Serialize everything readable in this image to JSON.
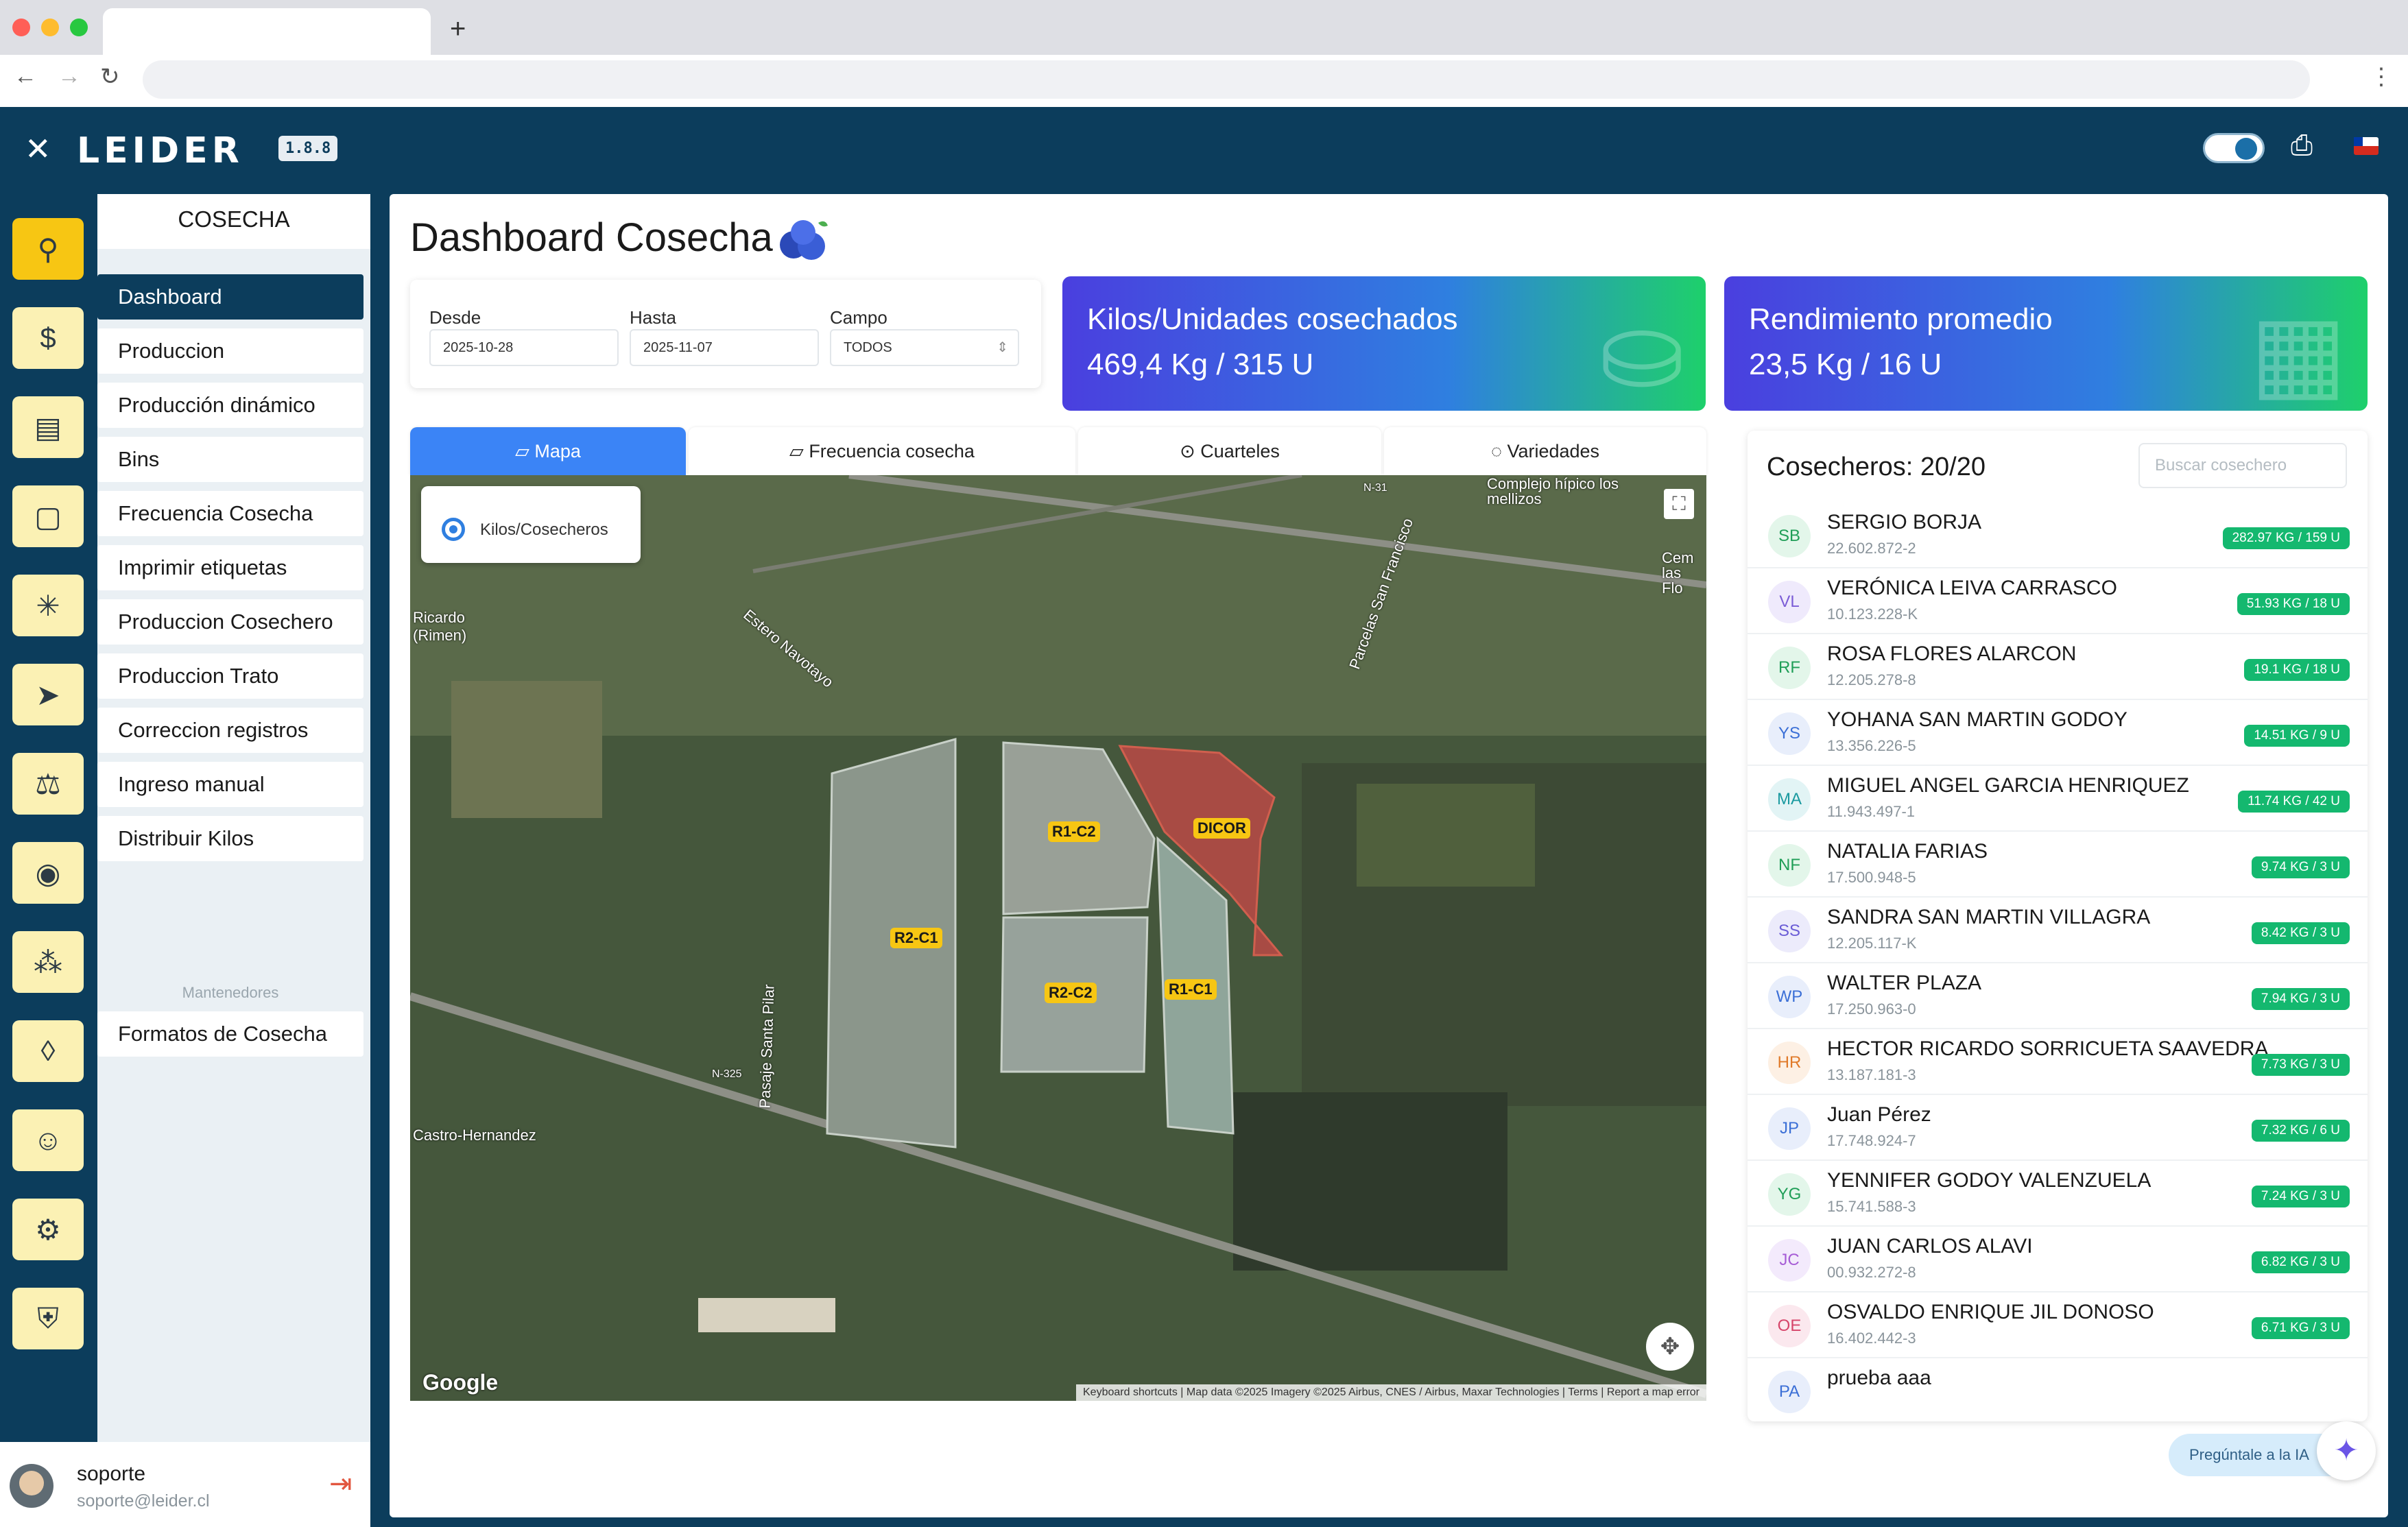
{
  "browser": {
    "new_tab": "+",
    "back": "←",
    "forward": "→",
    "reload": "↻",
    "menu": "⋮"
  },
  "app": {
    "close": "✕",
    "logo": "LEIDER",
    "version": "1.8.8"
  },
  "rail": {
    "icons": [
      "bike-icon",
      "invoice-icon",
      "receipt-icon",
      "clipboard-icon",
      "bug-icon",
      "navigation-icon",
      "scale-icon",
      "antenna-icon",
      "group-icon",
      "water-cost-icon",
      "worker-icon",
      "gear-icon",
      "shield-icon"
    ]
  },
  "submenu": {
    "title": "COSECHA",
    "items": [
      "Dashboard",
      "Produccion",
      "Producción dinámico",
      "Bins",
      "Frecuencia Cosecha",
      "Imprimir etiquetas",
      "Produccion Cosechero",
      "Produccion Trato",
      "Correccion registros",
      "Ingreso manual",
      "Distribuir Kilos"
    ],
    "section": "Mantenedores",
    "section_items": [
      "Formatos de Cosecha"
    ]
  },
  "user": {
    "name": "soporte",
    "email": "soporte@leider.cl"
  },
  "page": {
    "title": "Dashboard Cosecha"
  },
  "filters": {
    "desde_label": "Desde",
    "desde_value": "2025-10-28",
    "hasta_label": "Hasta",
    "hasta_value": "2025-11-07",
    "campo_label": "Campo",
    "campo_value": "TODOS"
  },
  "cards": [
    {
      "title": "Kilos/Unidades cosechados",
      "value": "469,4 Kg / 315 U"
    },
    {
      "title": "Rendimiento promedio",
      "value": "23,5 Kg / 16 U"
    }
  ],
  "tabs": [
    "Mapa",
    "Frecuencia cosecha",
    "Cuarteles",
    "Variedades"
  ],
  "map": {
    "legend": "Kilos/Cosecheros",
    "plots": [
      "R1-C2",
      "DICOR",
      "R2-C1",
      "R2-C2",
      "R1-C1"
    ],
    "places": [
      "Complejo hípico los mellizos",
      "Ricardo (Rimen)",
      "Estero Navotayo",
      "Parcelas San Francisco",
      "Pasaje Santa Pilar",
      "Castro-Hernandez",
      "N-325",
      "N-31",
      "Cem las Flo"
    ],
    "google": "Google",
    "attribution": "Keyboard shortcuts | Map data ©2025 Imagery ©2025 Airbus, CNES / Airbus, Maxar Technologies | Terms | Report a map error"
  },
  "harvesters": {
    "title": "Cosecheros: 20/20",
    "search_placeholder": "Buscar cosechero",
    "rows": [
      {
        "initials": "SB",
        "name": "SERGIO BORJA",
        "id": "22.602.872-2",
        "stat": "282.97 KG / 159 U",
        "color": "#1f9e57",
        "bg": "#e3f6ea"
      },
      {
        "initials": "VL",
        "name": "VERÓNICA LEIVA CARRASCO",
        "id": "10.123.228-K",
        "stat": "51.93 KG / 18 U",
        "color": "#7b5cd6",
        "bg": "#efeafc"
      },
      {
        "initials": "RF",
        "name": "ROSA FLORES ALARCON",
        "id": "12.205.278-8",
        "stat": "19.1 KG / 18 U",
        "color": "#1f9e57",
        "bg": "#e3f6ea"
      },
      {
        "initials": "YS",
        "name": "YOHANA SAN MARTIN GODOY",
        "id": "13.356.226-5",
        "stat": "14.51 KG / 9 U",
        "color": "#3b6fd6",
        "bg": "#e8eefb"
      },
      {
        "initials": "MA",
        "name": "MIGUEL ANGEL GARCIA HENRIQUEZ",
        "id": "11.943.497-1",
        "stat": "11.74 KG / 42 U",
        "color": "#1a9aa0",
        "bg": "#e2f4f5"
      },
      {
        "initials": "NF",
        "name": "NATALIA FARIAS",
        "id": "17.500.948-5",
        "stat": "9.74 KG / 3 U",
        "color": "#1f9e57",
        "bg": "#e3f6ea"
      },
      {
        "initials": "SS",
        "name": "SANDRA SAN MARTIN VILLAGRA",
        "id": "12.205.117-K",
        "stat": "8.42 KG / 3 U",
        "color": "#6a5cd6",
        "bg": "#ecebfb"
      },
      {
        "initials": "WP",
        "name": "WALTER PLAZA",
        "id": "17.250.963-0",
        "stat": "7.94 KG / 3 U",
        "color": "#3b6fd6",
        "bg": "#e8eefb"
      },
      {
        "initials": "HR",
        "name": "HECTOR RICARDO SORRICUETA SAAVEDRA",
        "id": "13.187.181-3",
        "stat": "7.73 KG / 3 U",
        "color": "#e07a2a",
        "bg": "#fdf0e4"
      },
      {
        "initials": "JP",
        "name": "Juan Pérez",
        "id": "17.748.924-7",
        "stat": "7.32 KG / 6 U",
        "color": "#3b6fd6",
        "bg": "#e8eefb"
      },
      {
        "initials": "YG",
        "name": "YENNIFER GODOY VALENZUELA",
        "id": "15.741.588-3",
        "stat": "7.24 KG / 3 U",
        "color": "#1f9e57",
        "bg": "#e3f6ea"
      },
      {
        "initials": "JC",
        "name": "JUAN CARLOS ALAVI",
        "id": "00.932.272-8",
        "stat": "6.82 KG / 3 U",
        "color": "#a65cd6",
        "bg": "#f3eafc"
      },
      {
        "initials": "OE",
        "name": "OSVALDO ENRIQUE JIL DONOSO",
        "id": "16.402.442-3",
        "stat": "6.71 KG / 3 U",
        "color": "#d6456a",
        "bg": "#fbe8ee"
      },
      {
        "initials": "PA",
        "name": "prueba aaa",
        "id": "",
        "stat": "",
        "color": "#3b6fd6",
        "bg": "#e8eefb"
      }
    ]
  },
  "ai": {
    "label": "Pregúntale a la IA"
  },
  "colors": {
    "primary": "#0c3d5c",
    "accent": "#f7c613",
    "tab_active": "#3b84f6",
    "badge": "#14b86f"
  }
}
